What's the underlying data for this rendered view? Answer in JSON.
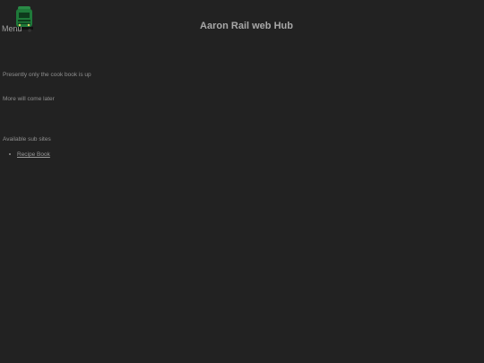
{
  "header": {
    "menu_label": "Menu",
    "title": "Aaron Rail web Hub",
    "logo_icon": "train-icon"
  },
  "content": {
    "line1": "Presently only the cook book is up",
    "line2": "More will come later",
    "subsites_heading": "Available sub sites",
    "subsites": [
      {
        "label": "Recipe Book"
      }
    ]
  },
  "colors": {
    "background": "#222222",
    "text": "#9a9a9a",
    "logo_green": "#1f7a3a"
  }
}
